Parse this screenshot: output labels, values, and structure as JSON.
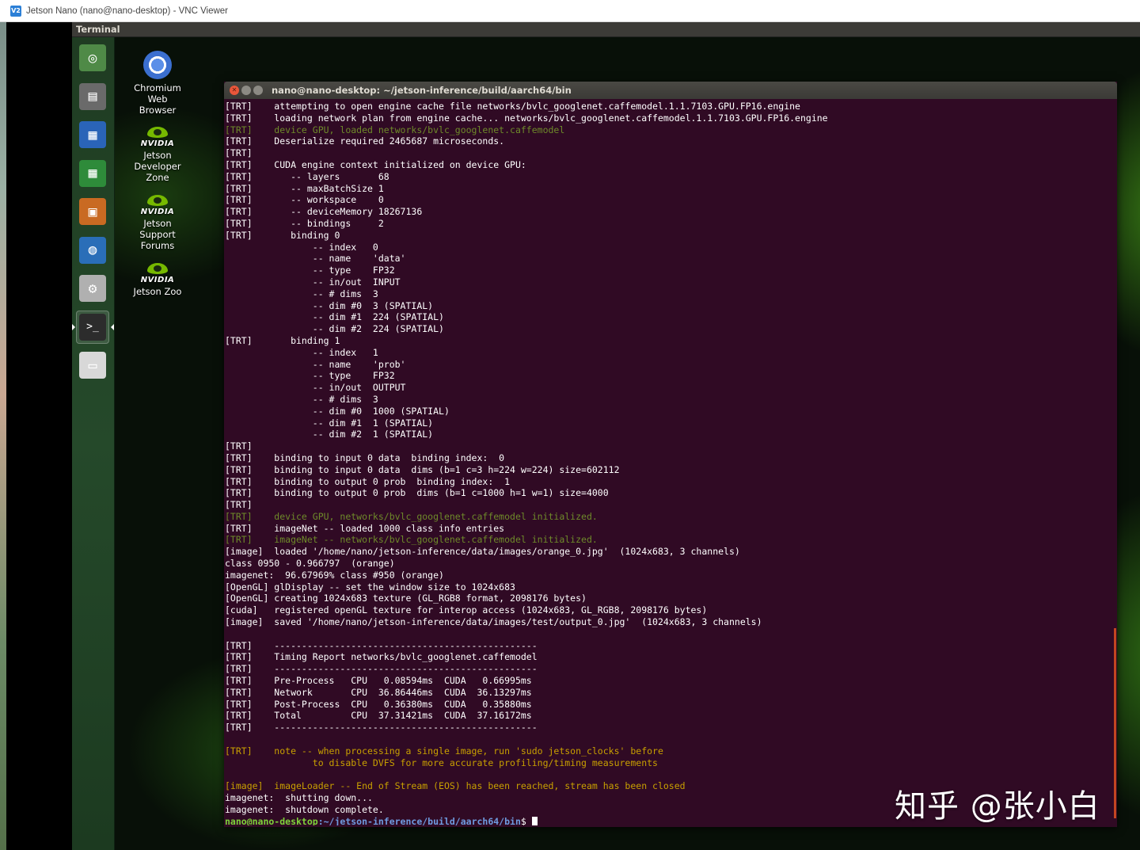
{
  "vnc": {
    "icon": "V2",
    "title": "Jetson Nano (nano@nano-desktop) - VNC Viewer"
  },
  "topbar": {
    "title": "Terminal"
  },
  "launcher": [
    {
      "name": "dash-icon",
      "glyph": "◎"
    },
    {
      "name": "files-icon",
      "glyph": "▤"
    },
    {
      "name": "writer-icon",
      "glyph": "▦"
    },
    {
      "name": "calc-icon",
      "glyph": "▦"
    },
    {
      "name": "impress-icon",
      "glyph": "▣"
    },
    {
      "name": "software-center-icon",
      "glyph": "◍"
    },
    {
      "name": "system-settings-icon",
      "glyph": "⚙"
    },
    {
      "name": "terminal-icon",
      "glyph": ">_"
    },
    {
      "name": "drive-icon",
      "glyph": "▭"
    }
  ],
  "desktop_icons": {
    "chromium": [
      "Chromium",
      "Web",
      "Browser"
    ],
    "dev_zone": {
      "brand": "NVIDIA",
      "lines": [
        "Jetson",
        "Developer",
        "Zone"
      ]
    },
    "forums": {
      "brand": "NVIDIA",
      "lines": [
        "Jetson",
        "Support",
        "Forums"
      ]
    },
    "zoo": {
      "brand": "NVIDIA",
      "lines": [
        "Jetson Zoo"
      ]
    }
  },
  "terminal": {
    "title": "nano@nano-desktop: ~/jetson-inference/build/aarch64/bin",
    "lines": [
      {
        "t": "[TRT]    attempting to open engine cache file networks/bvlc_googlenet.caffemodel.1.1.7103.GPU.FP16.engine"
      },
      {
        "t": "[TRT]    loading network plan from engine cache... networks/bvlc_googlenet.caffemodel.1.1.7103.GPU.FP16.engine"
      },
      {
        "t": "[TRT]    device GPU, loaded networks/bvlc_googlenet.caffemodel",
        "c": "green"
      },
      {
        "t": "[TRT]    Deserialize required 2465687 microseconds."
      },
      {
        "t": "[TRT]    "
      },
      {
        "t": "[TRT]    CUDA engine context initialized on device GPU:"
      },
      {
        "t": "[TRT]       -- layers       68"
      },
      {
        "t": "[TRT]       -- maxBatchSize 1"
      },
      {
        "t": "[TRT]       -- workspace    0"
      },
      {
        "t": "[TRT]       -- deviceMemory 18267136"
      },
      {
        "t": "[TRT]       -- bindings     2"
      },
      {
        "t": "[TRT]       binding 0"
      },
      {
        "t": "                -- index   0"
      },
      {
        "t": "                -- name    'data'"
      },
      {
        "t": "                -- type    FP32"
      },
      {
        "t": "                -- in/out  INPUT"
      },
      {
        "t": "                -- # dims  3"
      },
      {
        "t": "                -- dim #0  3 (SPATIAL)"
      },
      {
        "t": "                -- dim #1  224 (SPATIAL)"
      },
      {
        "t": "                -- dim #2  224 (SPATIAL)"
      },
      {
        "t": "[TRT]       binding 1"
      },
      {
        "t": "                -- index   1"
      },
      {
        "t": "                -- name    'prob'"
      },
      {
        "t": "                -- type    FP32"
      },
      {
        "t": "                -- in/out  OUTPUT"
      },
      {
        "t": "                -- # dims  3"
      },
      {
        "t": "                -- dim #0  1000 (SPATIAL)"
      },
      {
        "t": "                -- dim #1  1 (SPATIAL)"
      },
      {
        "t": "                -- dim #2  1 (SPATIAL)"
      },
      {
        "t": "[TRT]    "
      },
      {
        "t": "[TRT]    binding to input 0 data  binding index:  0"
      },
      {
        "t": "[TRT]    binding to input 0 data  dims (b=1 c=3 h=224 w=224) size=602112"
      },
      {
        "t": "[TRT]    binding to output 0 prob  binding index:  1"
      },
      {
        "t": "[TRT]    binding to output 0 prob  dims (b=1 c=1000 h=1 w=1) size=4000"
      },
      {
        "t": "[TRT]    "
      },
      {
        "t": "[TRT]    device GPU, networks/bvlc_googlenet.caffemodel initialized.",
        "c": "green"
      },
      {
        "t": "[TRT]    imageNet -- loaded 1000 class info entries"
      },
      {
        "t": "[TRT]    imageNet -- networks/bvlc_googlenet.caffemodel initialized.",
        "c": "green"
      },
      {
        "t": "[image]  loaded '/home/nano/jetson-inference/data/images/orange_0.jpg'  (1024x683, 3 channels)"
      },
      {
        "t": "class 0950 - 0.966797  (orange)"
      },
      {
        "t": "imagenet:  96.67969% class #950 (orange)"
      },
      {
        "t": "[OpenGL] glDisplay -- set the window size to 1024x683"
      },
      {
        "t": "[OpenGL] creating 1024x683 texture (GL_RGB8 format, 2098176 bytes)"
      },
      {
        "t": "[cuda]   registered openGL texture for interop access (1024x683, GL_RGB8, 2098176 bytes)"
      },
      {
        "t": "[image]  saved '/home/nano/jetson-inference/data/images/test/output_0.jpg'  (1024x683, 3 channels)"
      },
      {
        "t": ""
      },
      {
        "t": "[TRT]    ------------------------------------------------"
      },
      {
        "t": "[TRT]    Timing Report networks/bvlc_googlenet.caffemodel"
      },
      {
        "t": "[TRT]    ------------------------------------------------"
      },
      {
        "t": "[TRT]    Pre-Process   CPU   0.08594ms  CUDA   0.66995ms"
      },
      {
        "t": "[TRT]    Network       CPU  36.86446ms  CUDA  36.13297ms"
      },
      {
        "t": "[TRT]    Post-Process  CPU   0.36380ms  CUDA   0.35880ms"
      },
      {
        "t": "[TRT]    Total         CPU  37.31421ms  CUDA  37.16172ms"
      },
      {
        "t": "[TRT]    ------------------------------------------------"
      },
      {
        "t": ""
      },
      {
        "t": "[TRT]    note -- when processing a single image, run 'sudo jetson_clocks' before",
        "c": "yellow"
      },
      {
        "t": "                to disable DVFS for more accurate profiling/timing measurements",
        "c": "yellow"
      },
      {
        "t": ""
      },
      {
        "t": "[image]  imageLoader -- End of Stream (EOS) has been reached, stream has been closed",
        "c": "yellow"
      },
      {
        "t": "imagenet:  shutting down..."
      },
      {
        "t": "imagenet:  shutdown complete."
      }
    ],
    "prompt": {
      "user": "nano@nano-desktop",
      "path": ":~/jetson-inference/build/aarch64/bin",
      "symbol": "$ "
    }
  },
  "watermark": "知乎 @张小白",
  "colors": {
    "terminal_bg": "#300a24",
    "green_text": "#6e8a2a",
    "yellow_text": "#c8a000",
    "launcher_bg": "#25492a"
  }
}
